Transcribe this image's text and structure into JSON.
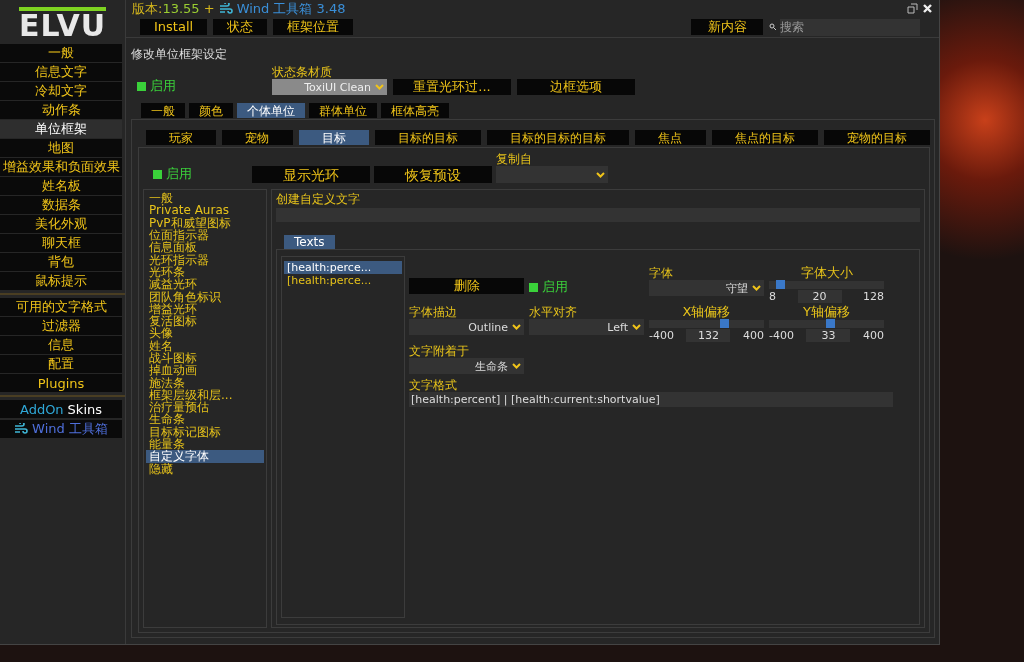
{
  "logo": "ELVU",
  "header": {
    "version_label": "版本:",
    "version": "13.55",
    "plus": "+",
    "addon": "Wind 工具箱 3.48"
  },
  "top_buttons": [
    "Install",
    "状态",
    "框架位置"
  ],
  "new_button": "新内容",
  "search": {
    "placeholder": "搜索"
  },
  "sidebar": {
    "groups": [
      [
        {
          "label": "一般",
          "selected": false
        },
        {
          "label": "信息文字",
          "selected": false
        },
        {
          "label": "冷却文字",
          "selected": false
        },
        {
          "label": "动作条",
          "selected": false
        },
        {
          "label": "单位框架",
          "selected": true
        },
        {
          "label": "地图",
          "selected": false
        },
        {
          "label": "增益效果和负面效果",
          "selected": false
        },
        {
          "label": "姓名板",
          "selected": false
        },
        {
          "label": "数据条",
          "selected": false
        },
        {
          "label": "美化外观",
          "selected": false
        },
        {
          "label": "聊天框",
          "selected": false
        },
        {
          "label": "背包",
          "selected": false
        },
        {
          "label": "鼠标提示",
          "selected": false
        }
      ],
      [
        {
          "label": "可用的文字格式",
          "selected": false
        },
        {
          "label": "过滤器",
          "selected": false
        },
        {
          "label": "信息",
          "selected": false
        },
        {
          "label": "配置",
          "selected": false
        },
        {
          "label": "Plugins",
          "selected": false
        }
      ]
    ],
    "addon_skins": {
      "prefix": "AddOn",
      "suffix": "Skins"
    },
    "wind": "Wind 工具箱"
  },
  "section_title": "修改单位框架设定",
  "enable": {
    "label": "启用",
    "checked": true
  },
  "texture": {
    "label": "状态条材质",
    "value": "ToxiUI Clean"
  },
  "top_actions": [
    "重置光环过...",
    "边框选项"
  ],
  "tabs": [
    {
      "label": "一般",
      "selected": false
    },
    {
      "label": "颜色",
      "selected": false
    },
    {
      "label": "个体单位",
      "selected": true
    },
    {
      "label": "群体单位",
      "selected": false
    },
    {
      "label": "框体高亮",
      "selected": false
    }
  ],
  "unit_tabs": [
    {
      "label": "玩家",
      "selected": false
    },
    {
      "label": "宠物",
      "selected": false
    },
    {
      "label": "目标",
      "selected": true
    },
    {
      "label": "目标的目标",
      "selected": false
    },
    {
      "label": "目标的目标的目标",
      "selected": false
    },
    {
      "label": "焦点",
      "selected": false
    },
    {
      "label": "焦点的目标",
      "selected": false
    },
    {
      "label": "宠物的目标",
      "selected": false
    }
  ],
  "unit_enable": {
    "label": "启用",
    "checked": true
  },
  "unit_actions": [
    "显示光环",
    "恢复预设"
  ],
  "copy_from": {
    "label": "复制自"
  },
  "tree": [
    {
      "label": "一般",
      "selected": false
    },
    {
      "label": "Private Auras",
      "selected": false
    },
    {
      "label": "PvP和威望图标",
      "selected": false
    },
    {
      "label": "位面指示器",
      "selected": false
    },
    {
      "label": "信息面板",
      "selected": false
    },
    {
      "label": "光环指示器",
      "selected": false
    },
    {
      "label": "光环条",
      "selected": false
    },
    {
      "label": "减益光环",
      "selected": false
    },
    {
      "label": "团队角色标识",
      "selected": false
    },
    {
      "label": "增益光环",
      "selected": false
    },
    {
      "label": "复活图标",
      "selected": false
    },
    {
      "label": "头像",
      "selected": false
    },
    {
      "label": "姓名",
      "selected": false
    },
    {
      "label": "战斗图标",
      "selected": false
    },
    {
      "label": "掉血动画",
      "selected": false
    },
    {
      "label": "施法条",
      "selected": false
    },
    {
      "label": "框架层级和层...",
      "selected": false
    },
    {
      "label": "治疗量预估",
      "selected": false
    },
    {
      "label": "生命条",
      "selected": false
    },
    {
      "label": "目标标记图标",
      "selected": false
    },
    {
      "label": "能量条",
      "selected": false
    },
    {
      "label": "自定义字体",
      "selected": true
    },
    {
      "label": "隐藏",
      "selected": false
    }
  ],
  "create_text": {
    "label": "创建自定义文字"
  },
  "texts_tab": {
    "label": "Texts",
    "selected": true
  },
  "texts": [
    {
      "label": "[health:perce...",
      "selected": true
    },
    {
      "label": "[health:perce...",
      "selected": false
    }
  ],
  "delete_button": "删除",
  "text_enable": {
    "label": "启用",
    "checked": true
  },
  "font": {
    "label": "字体",
    "value": "守望"
  },
  "font_size": {
    "label": "字体大小",
    "min": "8",
    "value": "20",
    "max": "128",
    "level": 0.1
  },
  "outline": {
    "label": "字体描边",
    "value": "Outline"
  },
  "align": {
    "label": "水平对齐",
    "value": "Left"
  },
  "x_offset": {
    "label": "X轴偏移",
    "min": "-400",
    "value": "132",
    "max": "400",
    "level": 0.665
  },
  "y_offset": {
    "label": "Y轴偏移",
    "min": "-400",
    "value": "33",
    "max": "400",
    "level": 0.54
  },
  "attach": {
    "label": "文字附着于",
    "value": "生命条"
  },
  "format": {
    "label": "文字格式",
    "value": "[health:percent] | [health:current:shortvalue]"
  }
}
